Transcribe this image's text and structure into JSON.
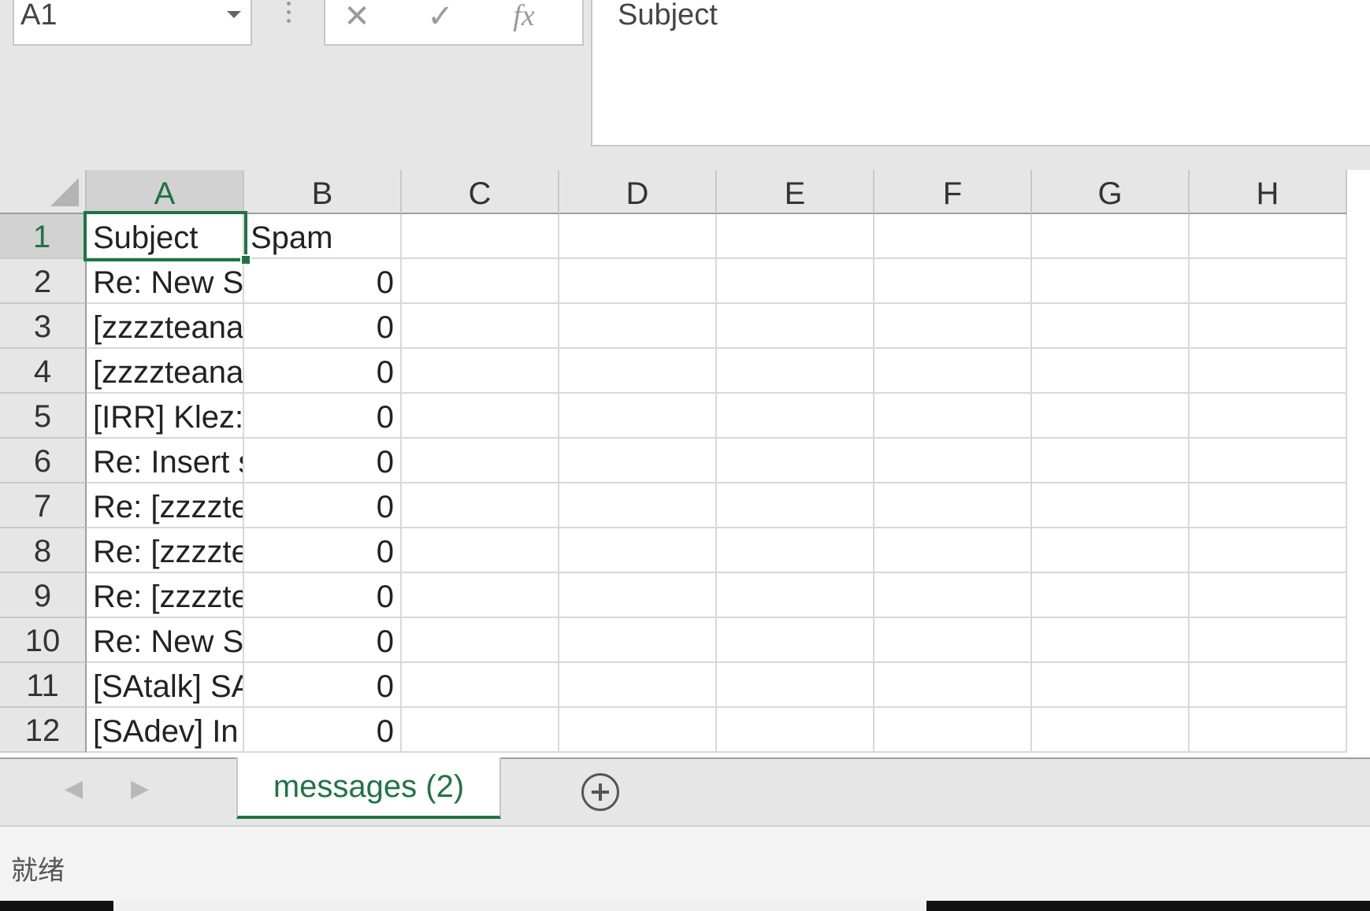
{
  "formula_bar": {
    "name_box": "A1",
    "formula": "Subject",
    "icons": [
      "cancel-icon",
      "confirm-icon",
      "fx-icon"
    ],
    "cancel_glyph": "✕",
    "confirm_glyph": "✓",
    "fx_glyph": "fx"
  },
  "grid": {
    "columns": [
      "A",
      "B",
      "C",
      "D",
      "E",
      "F",
      "G",
      "H"
    ],
    "selected_cell": "A1",
    "rows": [
      {
        "row": "1",
        "A": "Subject",
        "B": "Spam"
      },
      {
        "row": "2",
        "A": "Re: New S",
        "B": "0"
      },
      {
        "row": "3",
        "A": "[zzzzteana",
        "B": "0"
      },
      {
        "row": "4",
        "A": "[zzzzteana",
        "B": "0"
      },
      {
        "row": "5",
        "A": "[IRR] Klez:",
        "B": "0"
      },
      {
        "row": "6",
        "A": "Re: Insert s",
        "B": "0"
      },
      {
        "row": "7",
        "A": "Re: [zzzzte",
        "B": "0"
      },
      {
        "row": "8",
        "A": "Re: [zzzzte",
        "B": "0"
      },
      {
        "row": "9",
        "A": "Re: [zzzzte",
        "B": "0"
      },
      {
        "row": "10",
        "A": "Re: New S",
        "B": "0"
      },
      {
        "row": "11",
        "A": "[SAtalk] SA",
        "B": "0"
      },
      {
        "row": "12",
        "A": "[SAdev] In",
        "B": "0"
      }
    ]
  },
  "sheet_tabs": {
    "active": "messages (2)",
    "prev_glyph": "◀",
    "next_glyph": "▶"
  },
  "status_bar": {
    "text": "就绪"
  },
  "colors": {
    "accent": "#217346",
    "header_bg": "#e6e6e6",
    "grid_line": "#d8d8d8"
  }
}
